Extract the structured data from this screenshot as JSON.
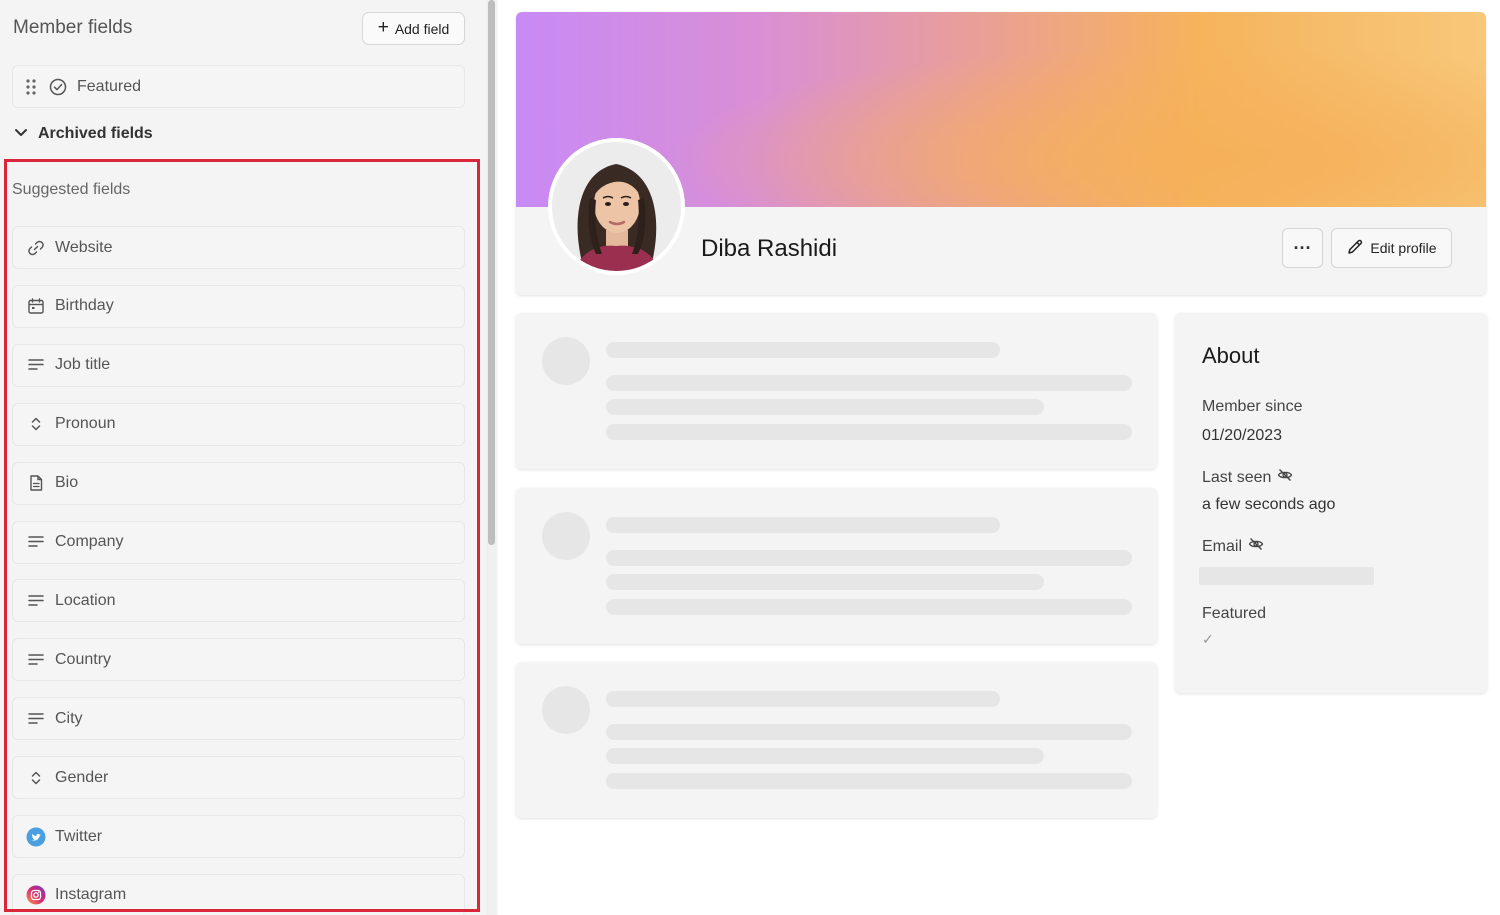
{
  "left_panel": {
    "title": "Member fields",
    "add_field_label": "Add field",
    "featured_field": {
      "label": "Featured",
      "icon": "check-circle-icon"
    },
    "archived_label": "Archived fields",
    "suggested_label": "Suggested fields",
    "suggested_fields": [
      {
        "label": "Website",
        "icon": "link-icon"
      },
      {
        "label": "Birthday",
        "icon": "calendar-icon"
      },
      {
        "label": "Job title",
        "icon": "text-lines-icon"
      },
      {
        "label": "Pronoun",
        "icon": "select-chevrons-icon"
      },
      {
        "label": "Bio",
        "icon": "document-icon"
      },
      {
        "label": "Company",
        "icon": "text-lines-icon"
      },
      {
        "label": "Location",
        "icon": "text-lines-icon"
      },
      {
        "label": "Country",
        "icon": "text-lines-icon"
      },
      {
        "label": "City",
        "icon": "text-lines-icon"
      },
      {
        "label": "Gender",
        "icon": "select-chevrons-icon"
      },
      {
        "label": "Twitter",
        "icon": "twitter-icon"
      },
      {
        "label": "Instagram",
        "icon": "instagram-icon"
      }
    ]
  },
  "profile": {
    "name": "Diba Rashidi",
    "more_label": "···",
    "edit_label": "Edit profile"
  },
  "about": {
    "title": "About",
    "member_since_label": "Member since",
    "member_since_value": "01/20/2023",
    "last_seen_label": "Last seen",
    "last_seen_value": "a few seconds ago",
    "email_label": "Email",
    "featured_label": "Featured",
    "featured_value": "✓"
  },
  "colors": {
    "highlight": "#d9263b",
    "cover_start": "#c88af5",
    "cover_end": "#f7c87a",
    "twitter": "#4a9fe0"
  }
}
